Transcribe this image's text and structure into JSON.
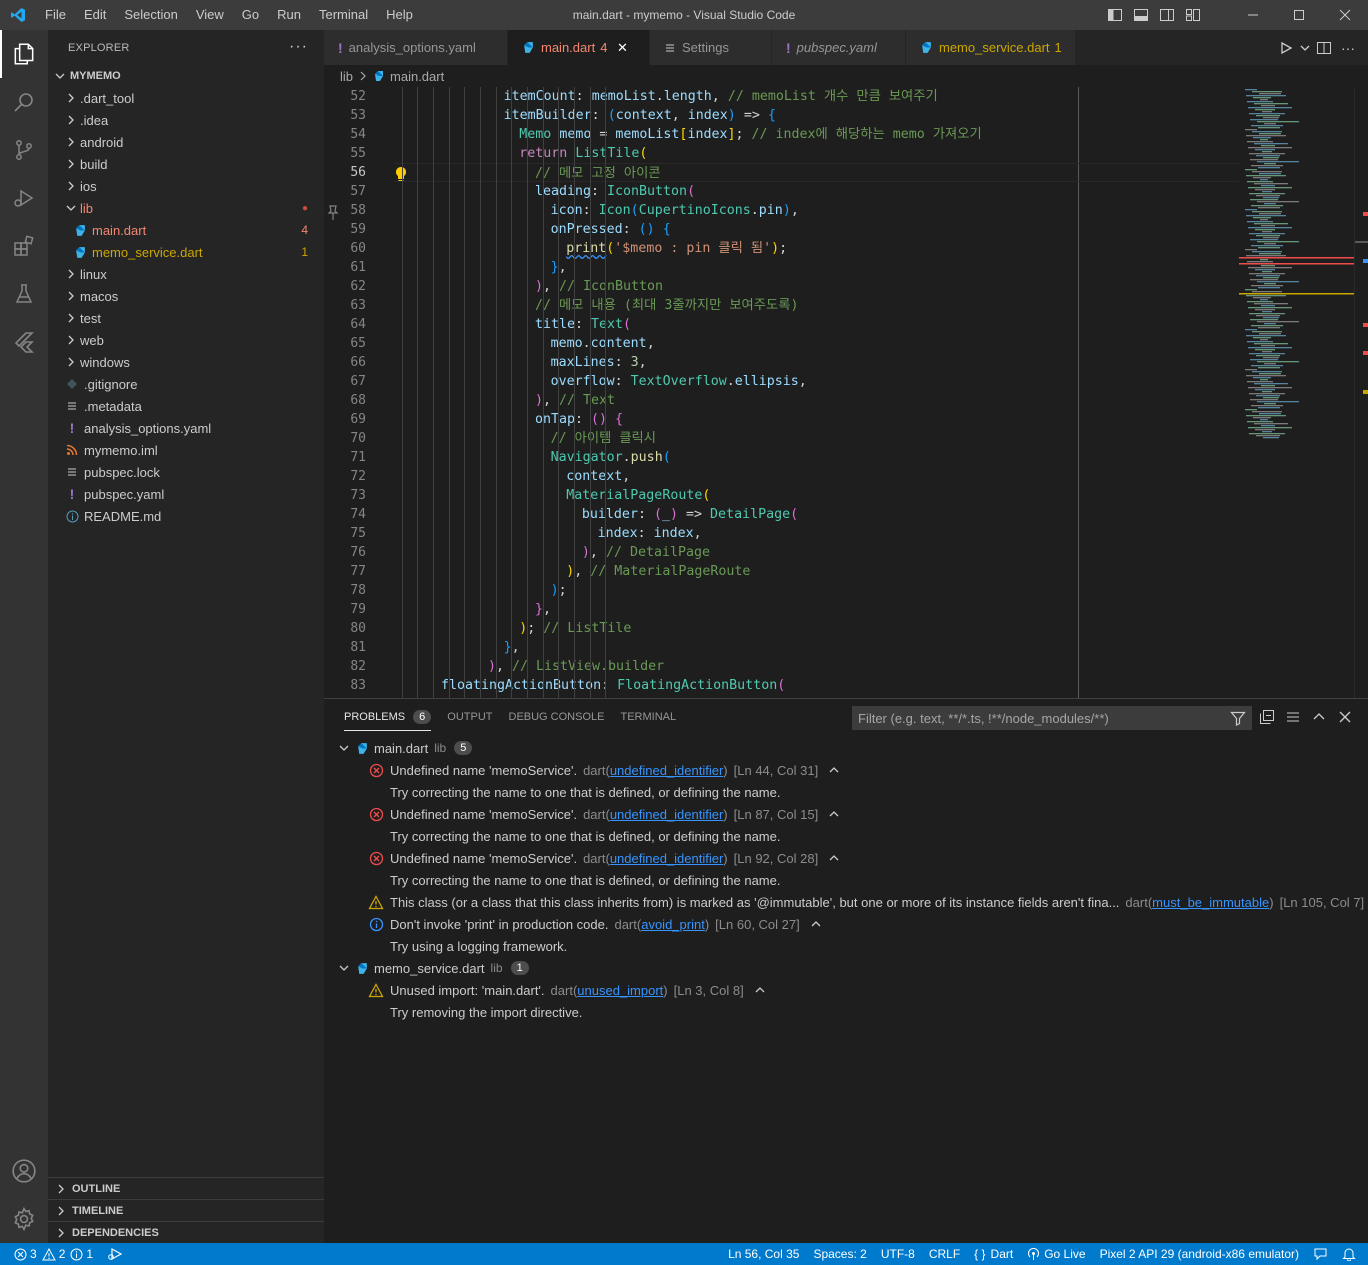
{
  "window": {
    "title": "main.dart - mymemo - Visual Studio Code",
    "menu": [
      "File",
      "Edit",
      "Selection",
      "View",
      "Go",
      "Run",
      "Terminal",
      "Help"
    ]
  },
  "sidebar": {
    "header": "EXPLORER",
    "more": "···",
    "root": "MYMEMO",
    "items": [
      {
        "label": ".dart_tool",
        "type": "folder",
        "depth": 0
      },
      {
        "label": ".idea",
        "type": "folder",
        "depth": 0
      },
      {
        "label": "android",
        "type": "folder",
        "depth": 0
      },
      {
        "label": "build",
        "type": "folder",
        "depth": 0
      },
      {
        "label": "ios",
        "type": "folder",
        "depth": 0
      },
      {
        "label": "lib",
        "type": "folder-open",
        "depth": 0,
        "status": "err",
        "badge": "●"
      },
      {
        "label": "main.dart",
        "type": "dart",
        "depth": 1,
        "status": "err",
        "badge": "4"
      },
      {
        "label": "memo_service.dart",
        "type": "dart",
        "depth": 1,
        "status": "warn",
        "badge": "1"
      },
      {
        "label": "linux",
        "type": "folder",
        "depth": 0
      },
      {
        "label": "macos",
        "type": "folder",
        "depth": 0
      },
      {
        "label": "test",
        "type": "folder",
        "depth": 0
      },
      {
        "label": "web",
        "type": "folder",
        "depth": 0
      },
      {
        "label": "windows",
        "type": "folder",
        "depth": 0
      },
      {
        "label": ".gitignore",
        "type": "git",
        "depth": 0
      },
      {
        "label": ".metadata",
        "type": "lines",
        "depth": 0
      },
      {
        "label": "analysis_options.yaml",
        "type": "yaml",
        "depth": 0
      },
      {
        "label": "mymemo.iml",
        "type": "rss",
        "depth": 0
      },
      {
        "label": "pubspec.lock",
        "type": "lines",
        "depth": 0
      },
      {
        "label": "pubspec.yaml",
        "type": "yaml",
        "depth": 0
      },
      {
        "label": "README.md",
        "type": "info",
        "depth": 0
      }
    ],
    "sections": [
      "OUTLINE",
      "TIMELINE",
      "DEPENDENCIES"
    ]
  },
  "tabs": [
    {
      "label": "analysis_options.yaml",
      "icon": "yaml",
      "italic": false,
      "active": false,
      "badge": ""
    },
    {
      "label": "main.dart",
      "icon": "dart",
      "italic": false,
      "active": true,
      "badge": "4"
    },
    {
      "label": "Settings",
      "icon": "settings",
      "italic": false,
      "active": false,
      "badge": ""
    },
    {
      "label": "pubspec.yaml",
      "icon": "yaml",
      "italic": true,
      "active": false,
      "badge": ""
    },
    {
      "label": "memo_service.dart",
      "icon": "dart",
      "italic": false,
      "active": false,
      "badge": "1",
      "warn": true
    }
  ],
  "breadcrumb": {
    "folder": "lib",
    "file": "main.dart"
  },
  "editor": {
    "current_line": 56,
    "lines": [
      {
        "n": 52,
        "indent": 9,
        "tokens": [
          [
            "itemCount",
            "prop"
          ],
          [
            ": ",
            "pun"
          ],
          [
            "memoList",
            "var"
          ],
          [
            ".",
            "pun"
          ],
          [
            "length",
            "prop"
          ],
          [
            ", ",
            "pun"
          ],
          [
            "// memoList 개수 만큼 보여주기",
            "com"
          ]
        ]
      },
      {
        "n": 53,
        "indent": 9,
        "tokens": [
          [
            "itemBuilder",
            "prop"
          ],
          [
            ": ",
            "pun"
          ],
          [
            "(",
            "b3"
          ],
          [
            "context",
            "var"
          ],
          [
            ", ",
            "pun"
          ],
          [
            "index",
            "var"
          ],
          [
            ")",
            "b3"
          ],
          [
            " => ",
            "pun"
          ],
          [
            "{",
            "b3"
          ]
        ]
      },
      {
        "n": 54,
        "indent": 10,
        "tokens": [
          [
            "Memo",
            "cls"
          ],
          [
            " ",
            "pun"
          ],
          [
            "memo",
            "var"
          ],
          [
            " = ",
            "pun"
          ],
          [
            "memoList",
            "var"
          ],
          [
            "[",
            "b1"
          ],
          [
            "index",
            "var"
          ],
          [
            "]",
            "b1"
          ],
          [
            "; ",
            "pun"
          ],
          [
            "// index에 해당하는 memo 가져오기",
            "com"
          ]
        ]
      },
      {
        "n": 55,
        "indent": 10,
        "tokens": [
          [
            "return",
            "kw"
          ],
          [
            " ",
            "pun"
          ],
          [
            "ListTile",
            "cls"
          ],
          [
            "(",
            "b1"
          ]
        ]
      },
      {
        "n": 56,
        "indent": 11,
        "tokens": [
          [
            "// 메모 고정 아이콘",
            "com"
          ]
        ]
      },
      {
        "n": 57,
        "indent": 11,
        "tokens": [
          [
            "leading",
            "prop"
          ],
          [
            ": ",
            "pun"
          ],
          [
            "IconButton",
            "cls"
          ],
          [
            "(",
            "b2"
          ]
        ]
      },
      {
        "n": 58,
        "indent": 12,
        "tokens": [
          [
            "icon",
            "prop"
          ],
          [
            ": ",
            "pun"
          ],
          [
            "Icon",
            "cls"
          ],
          [
            "(",
            "b3"
          ],
          [
            "CupertinoIcons",
            "cls"
          ],
          [
            ".",
            "pun"
          ],
          [
            "pin",
            "prop"
          ],
          [
            ")",
            "b3"
          ],
          [
            ",",
            "pun"
          ]
        ]
      },
      {
        "n": 59,
        "indent": 12,
        "tokens": [
          [
            "onPressed",
            "prop"
          ],
          [
            ": ",
            "pun"
          ],
          [
            "()",
            "b3"
          ],
          [
            " ",
            "pun"
          ],
          [
            "{",
            "b3"
          ]
        ]
      },
      {
        "n": 60,
        "indent": 13,
        "tokens": [
          [
            "print",
            "fn-squig"
          ],
          [
            "(",
            "b1"
          ],
          [
            "'$memo : pin 클릭 됨'",
            "str"
          ],
          [
            ")",
            "b1"
          ],
          [
            ";",
            "pun"
          ]
        ]
      },
      {
        "n": 61,
        "indent": 12,
        "tokens": [
          [
            "}",
            "b3"
          ],
          [
            ",",
            "pun"
          ]
        ]
      },
      {
        "n": 62,
        "indent": 11,
        "tokens": [
          [
            ")",
            "b2"
          ],
          [
            ", ",
            "pun"
          ],
          [
            "// IconButton",
            "com"
          ]
        ]
      },
      {
        "n": 63,
        "indent": 11,
        "tokens": [
          [
            "// 메모 내용 (최대 3줄까지만 보여주도록)",
            "com"
          ]
        ]
      },
      {
        "n": 64,
        "indent": 11,
        "tokens": [
          [
            "title",
            "prop"
          ],
          [
            ": ",
            "pun"
          ],
          [
            "Text",
            "cls"
          ],
          [
            "(",
            "b2"
          ]
        ]
      },
      {
        "n": 65,
        "indent": 12,
        "tokens": [
          [
            "memo",
            "var"
          ],
          [
            ".",
            "pun"
          ],
          [
            "content",
            "prop"
          ],
          [
            ",",
            "pun"
          ]
        ]
      },
      {
        "n": 66,
        "indent": 12,
        "tokens": [
          [
            "maxLines",
            "prop"
          ],
          [
            ": ",
            "pun"
          ],
          [
            "3",
            "num"
          ],
          [
            ",",
            "pun"
          ]
        ]
      },
      {
        "n": 67,
        "indent": 12,
        "tokens": [
          [
            "overflow",
            "prop"
          ],
          [
            ": ",
            "pun"
          ],
          [
            "TextOverflow",
            "cls"
          ],
          [
            ".",
            "pun"
          ],
          [
            "ellipsis",
            "prop"
          ],
          [
            ",",
            "pun"
          ]
        ]
      },
      {
        "n": 68,
        "indent": 11,
        "tokens": [
          [
            ")",
            "b2"
          ],
          [
            ", ",
            "pun"
          ],
          [
            "// Text",
            "com"
          ]
        ]
      },
      {
        "n": 69,
        "indent": 11,
        "tokens": [
          [
            "onTap",
            "prop"
          ],
          [
            ": ",
            "pun"
          ],
          [
            "()",
            "b2"
          ],
          [
            " ",
            "pun"
          ],
          [
            "{",
            "b2"
          ]
        ]
      },
      {
        "n": 70,
        "indent": 12,
        "tokens": [
          [
            "// 아이템 클릭시",
            "com"
          ]
        ]
      },
      {
        "n": 71,
        "indent": 12,
        "tokens": [
          [
            "Navigator",
            "cls"
          ],
          [
            ".",
            "pun"
          ],
          [
            "push",
            "fn"
          ],
          [
            "(",
            "b3"
          ]
        ]
      },
      {
        "n": 72,
        "indent": 13,
        "tokens": [
          [
            "context",
            "var"
          ],
          [
            ",",
            "pun"
          ]
        ]
      },
      {
        "n": 73,
        "indent": 13,
        "tokens": [
          [
            "MaterialPageRoute",
            "cls"
          ],
          [
            "(",
            "b1"
          ]
        ]
      },
      {
        "n": 74,
        "indent": 14,
        "tokens": [
          [
            "builder",
            "prop"
          ],
          [
            ": ",
            "pun"
          ],
          [
            "(",
            "b2"
          ],
          [
            "_",
            "var"
          ],
          [
            ")",
            "b2"
          ],
          [
            " => ",
            "pun"
          ],
          [
            "DetailPage",
            "cls"
          ],
          [
            "(",
            "b2"
          ]
        ]
      },
      {
        "n": 75,
        "indent": 15,
        "tokens": [
          [
            "index",
            "prop"
          ],
          [
            ": ",
            "pun"
          ],
          [
            "index",
            "var"
          ],
          [
            ",",
            "pun"
          ]
        ]
      },
      {
        "n": 76,
        "indent": 14,
        "tokens": [
          [
            ")",
            "b2"
          ],
          [
            ", ",
            "pun"
          ],
          [
            "// DetailPage",
            "com"
          ]
        ]
      },
      {
        "n": 77,
        "indent": 13,
        "tokens": [
          [
            ")",
            "b1"
          ],
          [
            ", ",
            "pun"
          ],
          [
            "// MaterialPageRoute",
            "com"
          ]
        ]
      },
      {
        "n": 78,
        "indent": 12,
        "tokens": [
          [
            ")",
            "b3"
          ],
          [
            ";",
            "pun"
          ]
        ]
      },
      {
        "n": 79,
        "indent": 11,
        "tokens": [
          [
            "}",
            "b2"
          ],
          [
            ",",
            "pun"
          ]
        ]
      },
      {
        "n": 80,
        "indent": 10,
        "tokens": [
          [
            ")",
            "b1"
          ],
          [
            "; ",
            "pun"
          ],
          [
            "// ListTile",
            "com"
          ]
        ]
      },
      {
        "n": 81,
        "indent": 9,
        "tokens": [
          [
            "}",
            "b3"
          ],
          [
            ",",
            "pun"
          ]
        ]
      },
      {
        "n": 82,
        "indent": 8,
        "tokens": [
          [
            ")",
            "b2"
          ],
          [
            ", ",
            "pun"
          ],
          [
            "// ListView.builder",
            "com"
          ]
        ]
      },
      {
        "n": 83,
        "indent": 5,
        "tokens": [
          [
            "floatingActionButton",
            "prop"
          ],
          [
            ": ",
            "pun"
          ],
          [
            "FloatingActionButton",
            "cls"
          ],
          [
            "(",
            "b2"
          ]
        ]
      }
    ]
  },
  "panel": {
    "tabs": [
      {
        "label": "PROBLEMS",
        "active": true,
        "count": "6"
      },
      {
        "label": "OUTPUT",
        "active": false
      },
      {
        "label": "DEBUG CONSOLE",
        "active": false
      },
      {
        "label": "TERMINAL",
        "active": false
      }
    ],
    "filter_placeholder": "Filter (e.g. text, **/*.ts, !**/node_modules/**)",
    "groups": [
      {
        "file": "main.dart",
        "folder": "lib",
        "count": "5",
        "problems": [
          {
            "severity": "error",
            "message": "Undefined name 'memoService'.",
            "source": "dart",
            "code": "undefined_identifier",
            "location": "[Ln 44, Col 31]",
            "hint": "Try correcting the name to one that is defined, or defining the name."
          },
          {
            "severity": "error",
            "message": "Undefined name 'memoService'.",
            "source": "dart",
            "code": "undefined_identifier",
            "location": "[Ln 87, Col 15]",
            "hint": "Try correcting the name to one that is defined, or defining the name."
          },
          {
            "severity": "error",
            "message": "Undefined name 'memoService'.",
            "source": "dart",
            "code": "undefined_identifier",
            "location": "[Ln 92, Col 28]",
            "hint": "Try correcting the name to one that is defined, or defining the name."
          },
          {
            "severity": "warning",
            "message": "This class (or a class that this class inherits from) is marked as '@immutable', but one or more of its instance fields aren't fina...",
            "source": "dart",
            "code": "must_be_immutable",
            "location": "[Ln 105, Col 7]",
            "hint": ""
          },
          {
            "severity": "info",
            "message": "Don't invoke 'print' in production code.",
            "source": "dart",
            "code": "avoid_print",
            "location": "[Ln 60, Col 27]",
            "hint": "Try using a logging framework."
          }
        ]
      },
      {
        "file": "memo_service.dart",
        "folder": "lib",
        "count": "1",
        "problems": [
          {
            "severity": "warning",
            "message": "Unused import: 'main.dart'.",
            "source": "dart",
            "code": "unused_import",
            "location": "[Ln 3, Col 8]",
            "hint": "Try removing the import directive."
          }
        ]
      }
    ]
  },
  "statusbar": {
    "errors": "3",
    "warnings": "2",
    "infos": "1",
    "position": "Ln 56, Col 35",
    "spaces": "Spaces: 2",
    "encoding": "UTF-8",
    "eol": "CRLF",
    "language": "Dart",
    "golive": "Go Live",
    "device": "Pixel 2 API 29 (android-x86 emulator)"
  },
  "colors": {
    "accent": "#007acc",
    "error": "#f48771",
    "warning": "#cca700",
    "info": "#3794ff"
  }
}
